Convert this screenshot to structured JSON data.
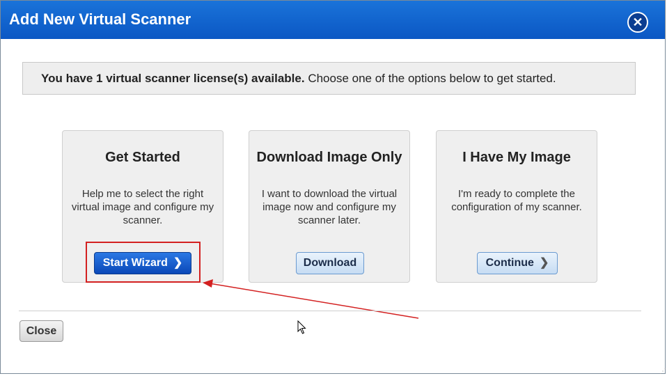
{
  "dialog": {
    "title": "Add New Virtual Scanner",
    "close_icon": "close-x-icon"
  },
  "banner": {
    "bold_text": "You have 1 virtual scanner license(s) available.",
    "text": " Choose one of the options below to get started."
  },
  "cards": [
    {
      "title": "Get Started",
      "description": "Help me to select the right virtual image and configure my scanner.",
      "button_label": "Start Wizard",
      "button_icon": "chevron-right-icon"
    },
    {
      "title": "Download Image Only",
      "description": "I want to download the virtual image now and configure my scanner later.",
      "button_label": "Download"
    },
    {
      "title": "I Have My Image",
      "description": "I'm ready to complete the configuration of my scanner.",
      "button_label": "Continue",
      "button_icon": "chevron-right-icon"
    }
  ],
  "footer": {
    "close_label": "Close"
  },
  "colors": {
    "titlebar": "#0b57c4",
    "primary_button": "#0a48b8",
    "annotation": "#d32020"
  }
}
